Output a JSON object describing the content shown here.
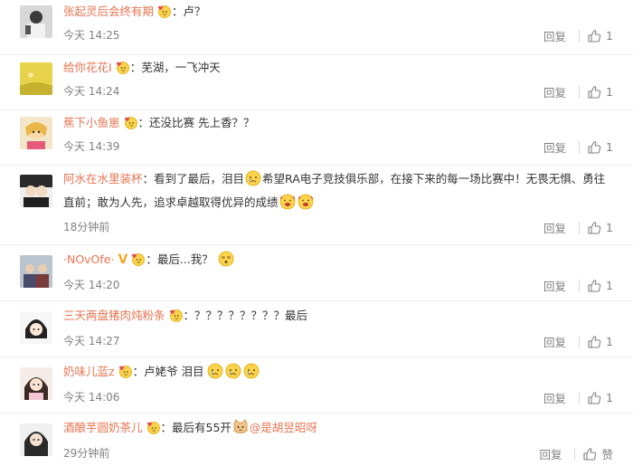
{
  "comments": [
    {
      "username": "张起灵后会终有期",
      "badge": "heart-face-badge",
      "content": "：卢？",
      "time": "今天 14:25",
      "reply": "回复",
      "likes": "1"
    },
    {
      "username": "给你花花I",
      "badge": "heart-face-badge",
      "content": "：芜湖，一飞冲天",
      "time": "今天 14:24",
      "reply": "回复",
      "likes": "1"
    },
    {
      "username": "蕉下小鱼崽",
      "badge": "heart-face-badge",
      "content": "：还没比赛 先上香？？",
      "time": "今天 14:39",
      "reply": "回复",
      "likes": "1"
    },
    {
      "username": "阿水在水里装杯",
      "content_part1": "：看到了最后，泪目",
      "content_part2": "希望RA电子竞技俱乐部，在接下来的每一场比赛中！无畏无惧、勇往直前；敢为人先，追求卓越取得优异的成绩",
      "time": "18分钟前",
      "reply": "回复",
      "likes": "1"
    },
    {
      "username": "·NOvOfe·",
      "vip": "V",
      "badge": "heart-face-badge",
      "content": "：最后...我？",
      "time": "今天 14:20",
      "reply": "回复",
      "likes": "1"
    },
    {
      "username": "三天两盘猪肉炖粉条",
      "badge": "heart-face-badge",
      "content": "：？？？？？？？？最后",
      "time": "今天 14:27",
      "reply": "回复",
      "likes": "1"
    },
    {
      "username": "奶味儿蓝z",
      "badge": "heart-face-badge",
      "content": "：卢姥爷 泪目",
      "time": "今天 14:06",
      "reply": "回复",
      "likes": "1"
    },
    {
      "username": "酒酿芋圆奶茶儿",
      "badge": "heart-face-badge",
      "content": "：最后有55开",
      "mention": "@是胡昱昭呀",
      "time": "29分钟前",
      "reply": "回复",
      "likes": "赞"
    }
  ],
  "colors": {
    "username": "#eb7350",
    "text": "#333333",
    "meta": "#808080",
    "vip": "#f5a623"
  }
}
